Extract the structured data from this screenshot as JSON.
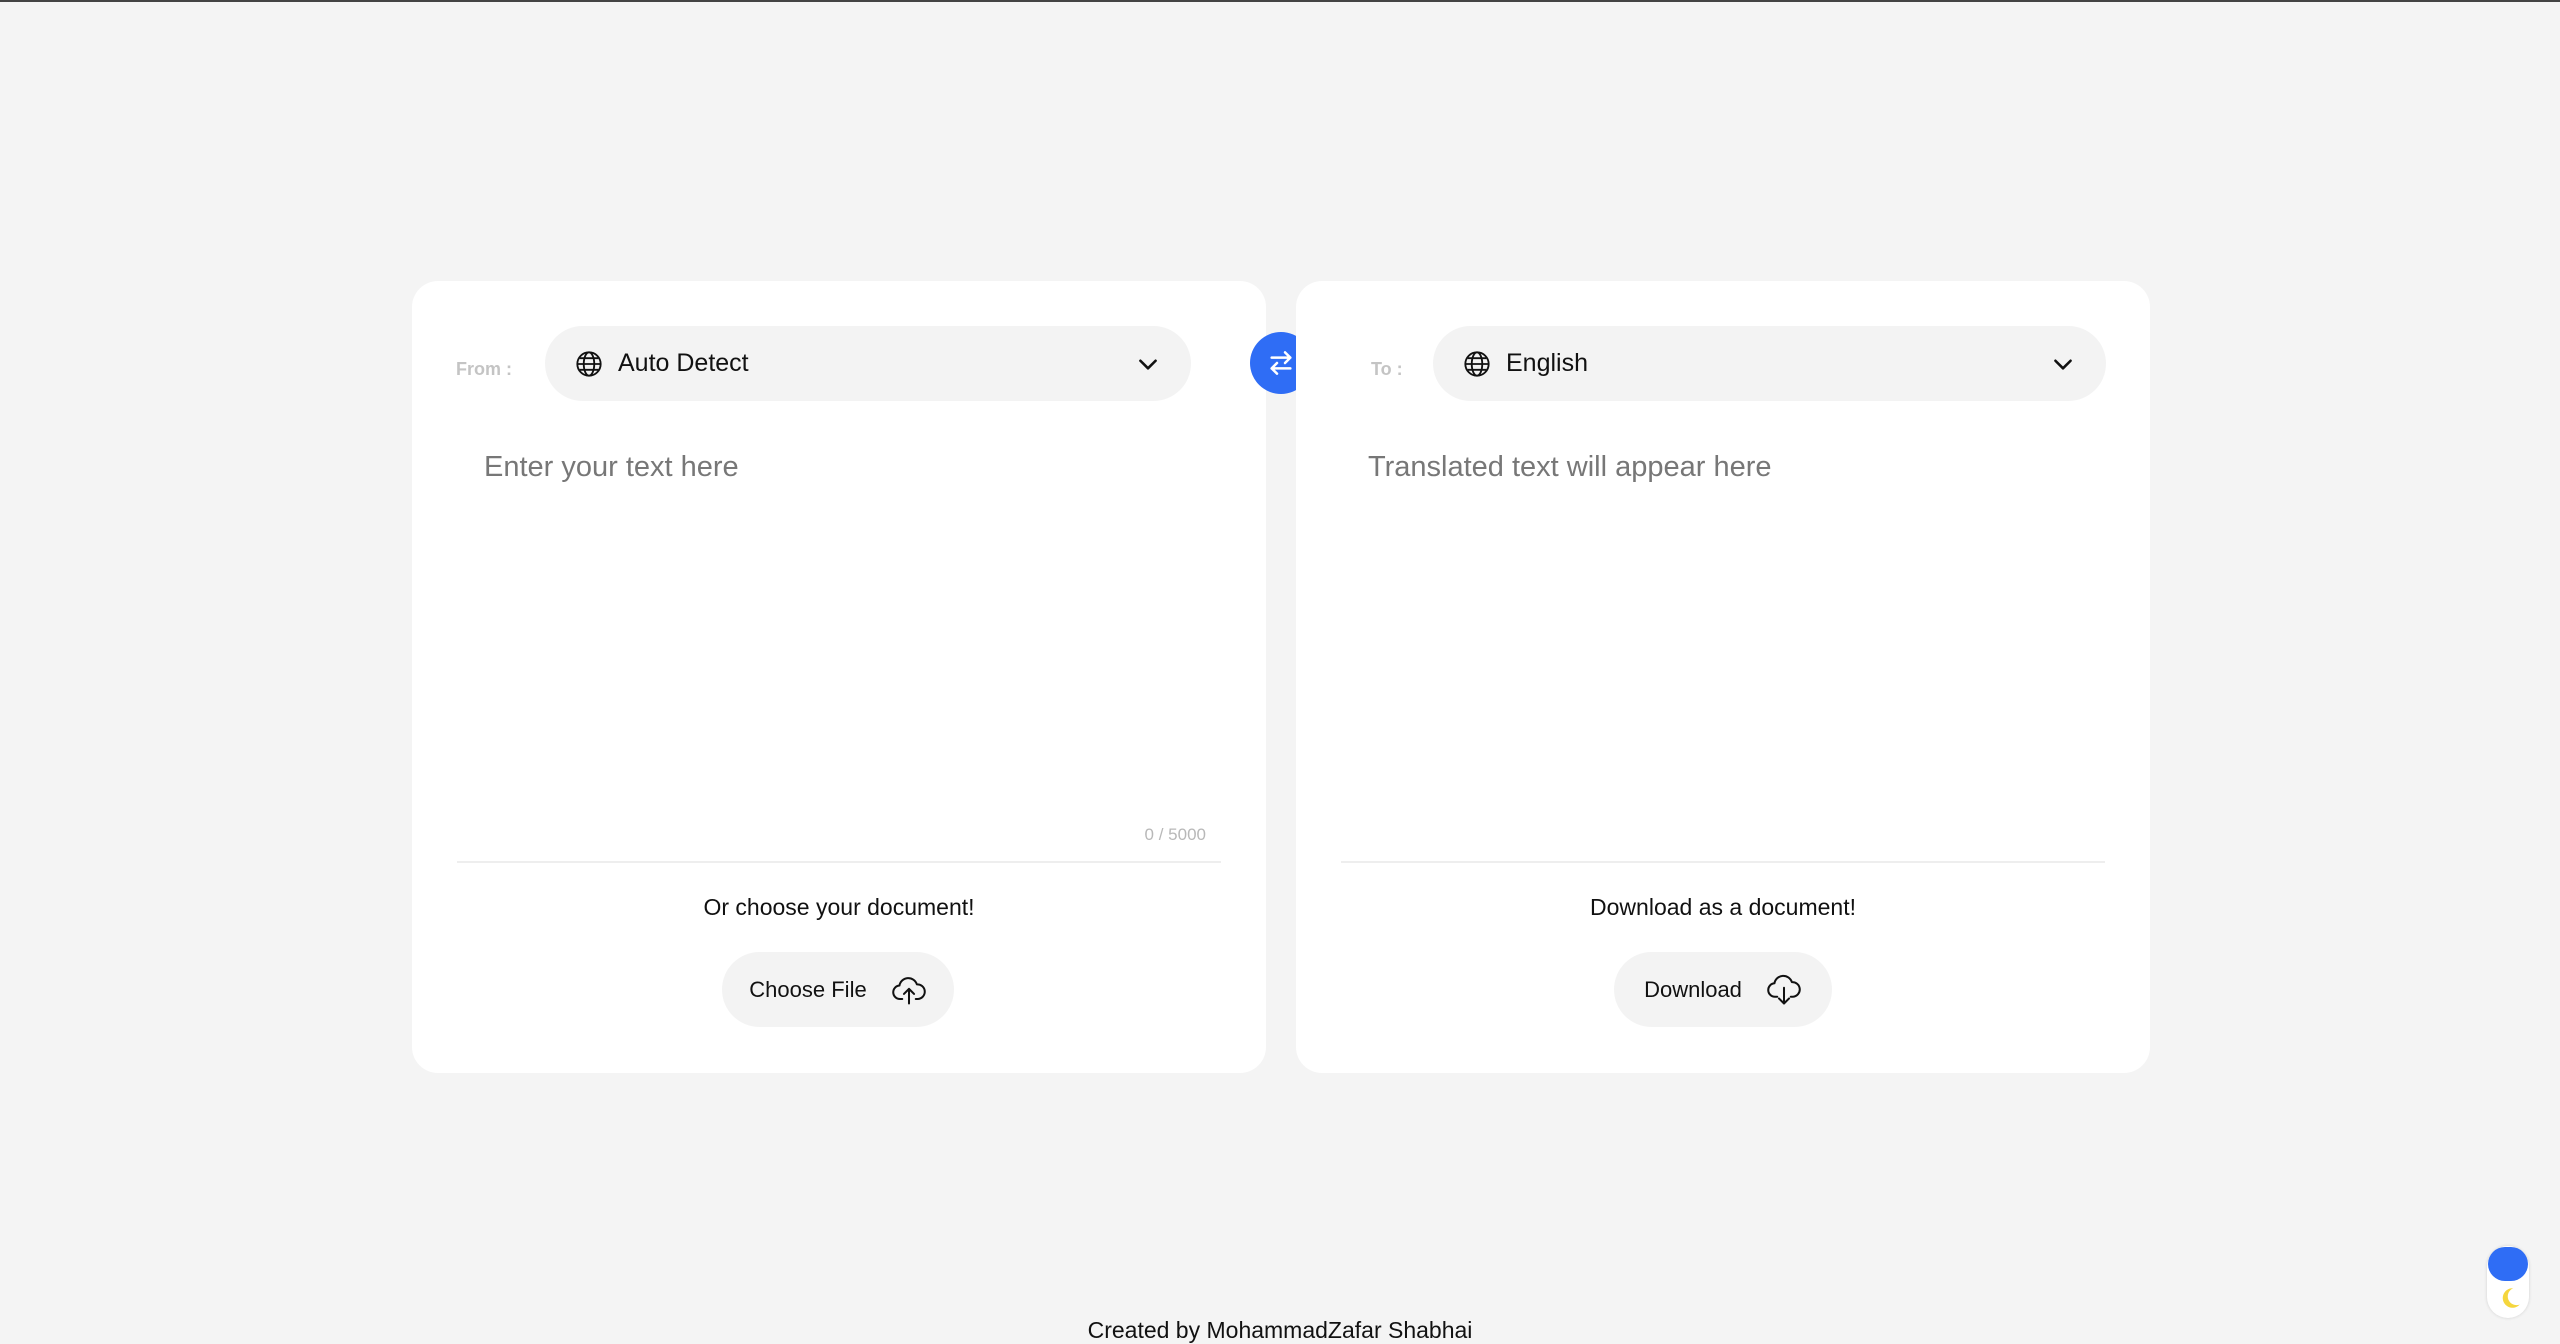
{
  "source": {
    "label": "From :",
    "language": "Auto Detect",
    "placeholder": "Enter your text here",
    "counter": "0 / 5000",
    "doc_caption": "Or choose your document!",
    "button_label": "Choose File",
    "icon": "cloud-upload-icon"
  },
  "target": {
    "label": "To :",
    "language": "English",
    "placeholder": "Translated text will appear here",
    "doc_caption": "Download as a document!",
    "button_label": "Download",
    "icon": "cloud-download-icon"
  },
  "swap_icon": "swap-arrows-icon",
  "footer": "Created by MohammadZafar Shabhai",
  "theme_icon": "moon-icon",
  "colors": {
    "accent": "#2f6df5",
    "background": "#f4f4f4",
    "card": "#ffffff",
    "moon": "#f5d63d"
  }
}
